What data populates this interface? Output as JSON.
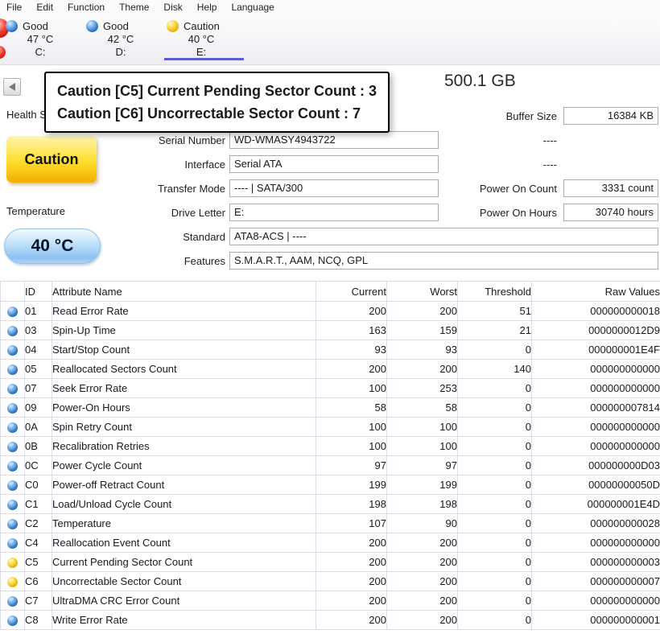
{
  "menu": {
    "items": [
      {
        "label": "File"
      },
      {
        "label": "Edit"
      },
      {
        "label": "Function"
      },
      {
        "label": "Theme"
      },
      {
        "label": "Disk"
      },
      {
        "label": "Help"
      },
      {
        "label": "Language"
      }
    ]
  },
  "tabs": [
    {
      "status": "Good",
      "temp": "47 °C",
      "letter": "C:",
      "color": "blue",
      "selected": false
    },
    {
      "status": "Good",
      "temp": "42 °C",
      "letter": "D:",
      "color": "blue",
      "selected": false
    },
    {
      "status": "Caution",
      "temp": "40 °C",
      "letter": "E:",
      "color": "yellow",
      "selected": true
    }
  ],
  "title": {
    "capacity": "500.1 GB"
  },
  "tooltip": {
    "line1": "Caution [C5] Current Pending Sector Count : 3",
    "line2": "Caution [C6] Uncorrectable Sector Count : 7"
  },
  "health": {
    "label": "Health Status",
    "status": "Caution"
  },
  "temperature": {
    "label": "Temperature",
    "value": "40 °C"
  },
  "info": {
    "left": [
      {
        "label": "Serial Number",
        "value": "WD-WMASY4943722"
      },
      {
        "label": "Interface",
        "value": "Serial ATA"
      },
      {
        "label": "Transfer Mode",
        "value": "---- | SATA/300"
      },
      {
        "label": "Drive Letter",
        "value": "E:"
      }
    ],
    "wide": [
      {
        "label": "Standard",
        "value": "ATA8-ACS | ----"
      },
      {
        "label": "Features",
        "value": "S.M.A.R.T., AAM, NCQ, GPL"
      }
    ],
    "right": [
      {
        "label": "Buffer Size",
        "value": "16384 KB",
        "boxed": true
      },
      {
        "label": "----",
        "value": "",
        "boxed": false
      },
      {
        "label": "----",
        "value": "",
        "boxed": false
      },
      {
        "label": "Power On Count",
        "value": "3331 count",
        "boxed": true
      },
      {
        "label": "Power On Hours",
        "value": "30740 hours",
        "boxed": true
      }
    ]
  },
  "table": {
    "headers": {
      "id": "ID",
      "name": "Attribute Name",
      "current": "Current",
      "worst": "Worst",
      "threshold": "Threshold",
      "raw": "Raw Values"
    },
    "rows": [
      {
        "status": "good",
        "id": "01",
        "name": "Read Error Rate",
        "current": "200",
        "worst": "200",
        "threshold": "51",
        "raw": "000000000018"
      },
      {
        "status": "good",
        "id": "03",
        "name": "Spin-Up Time",
        "current": "163",
        "worst": "159",
        "threshold": "21",
        "raw": "0000000012D9"
      },
      {
        "status": "good",
        "id": "04",
        "name": "Start/Stop Count",
        "current": "93",
        "worst": "93",
        "threshold": "0",
        "raw": "000000001E4F"
      },
      {
        "status": "good",
        "id": "05",
        "name": "Reallocated Sectors Count",
        "current": "200",
        "worst": "200",
        "threshold": "140",
        "raw": "000000000000"
      },
      {
        "status": "good",
        "id": "07",
        "name": "Seek Error Rate",
        "current": "100",
        "worst": "253",
        "threshold": "0",
        "raw": "000000000000"
      },
      {
        "status": "good",
        "id": "09",
        "name": "Power-On Hours",
        "current": "58",
        "worst": "58",
        "threshold": "0",
        "raw": "000000007814"
      },
      {
        "status": "good",
        "id": "0A",
        "name": "Spin Retry Count",
        "current": "100",
        "worst": "100",
        "threshold": "0",
        "raw": "000000000000"
      },
      {
        "status": "good",
        "id": "0B",
        "name": "Recalibration Retries",
        "current": "100",
        "worst": "100",
        "threshold": "0",
        "raw": "000000000000"
      },
      {
        "status": "good",
        "id": "0C",
        "name": "Power Cycle Count",
        "current": "97",
        "worst": "97",
        "threshold": "0",
        "raw": "000000000D03"
      },
      {
        "status": "good",
        "id": "C0",
        "name": "Power-off Retract Count",
        "current": "199",
        "worst": "199",
        "threshold": "0",
        "raw": "00000000050D"
      },
      {
        "status": "good",
        "id": "C1",
        "name": "Load/Unload Cycle Count",
        "current": "198",
        "worst": "198",
        "threshold": "0",
        "raw": "000000001E4D"
      },
      {
        "status": "good",
        "id": "C2",
        "name": "Temperature",
        "current": "107",
        "worst": "90",
        "threshold": "0",
        "raw": "000000000028"
      },
      {
        "status": "good",
        "id": "C4",
        "name": "Reallocation Event Count",
        "current": "200",
        "worst": "200",
        "threshold": "0",
        "raw": "000000000000"
      },
      {
        "status": "caution",
        "id": "C5",
        "name": "Current Pending Sector Count",
        "current": "200",
        "worst": "200",
        "threshold": "0",
        "raw": "000000000003"
      },
      {
        "status": "caution",
        "id": "C6",
        "name": "Uncorrectable Sector Count",
        "current": "200",
        "worst": "200",
        "threshold": "0",
        "raw": "000000000007"
      },
      {
        "status": "good",
        "id": "C7",
        "name": "UltraDMA CRC Error Count",
        "current": "200",
        "worst": "200",
        "threshold": "0",
        "raw": "000000000000"
      },
      {
        "status": "good",
        "id": "C8",
        "name": "Write Error Rate",
        "current": "200",
        "worst": "200",
        "threshold": "0",
        "raw": "000000000001"
      }
    ]
  },
  "colors": {
    "good_status": "#2f7fd6",
    "caution_status": "#f5c21a",
    "selected_tab_underline": "#5b5fc7",
    "tooltip_border": "#000000",
    "health_badge": "#ffd920",
    "temperature_badge": "#9fd0f5"
  }
}
